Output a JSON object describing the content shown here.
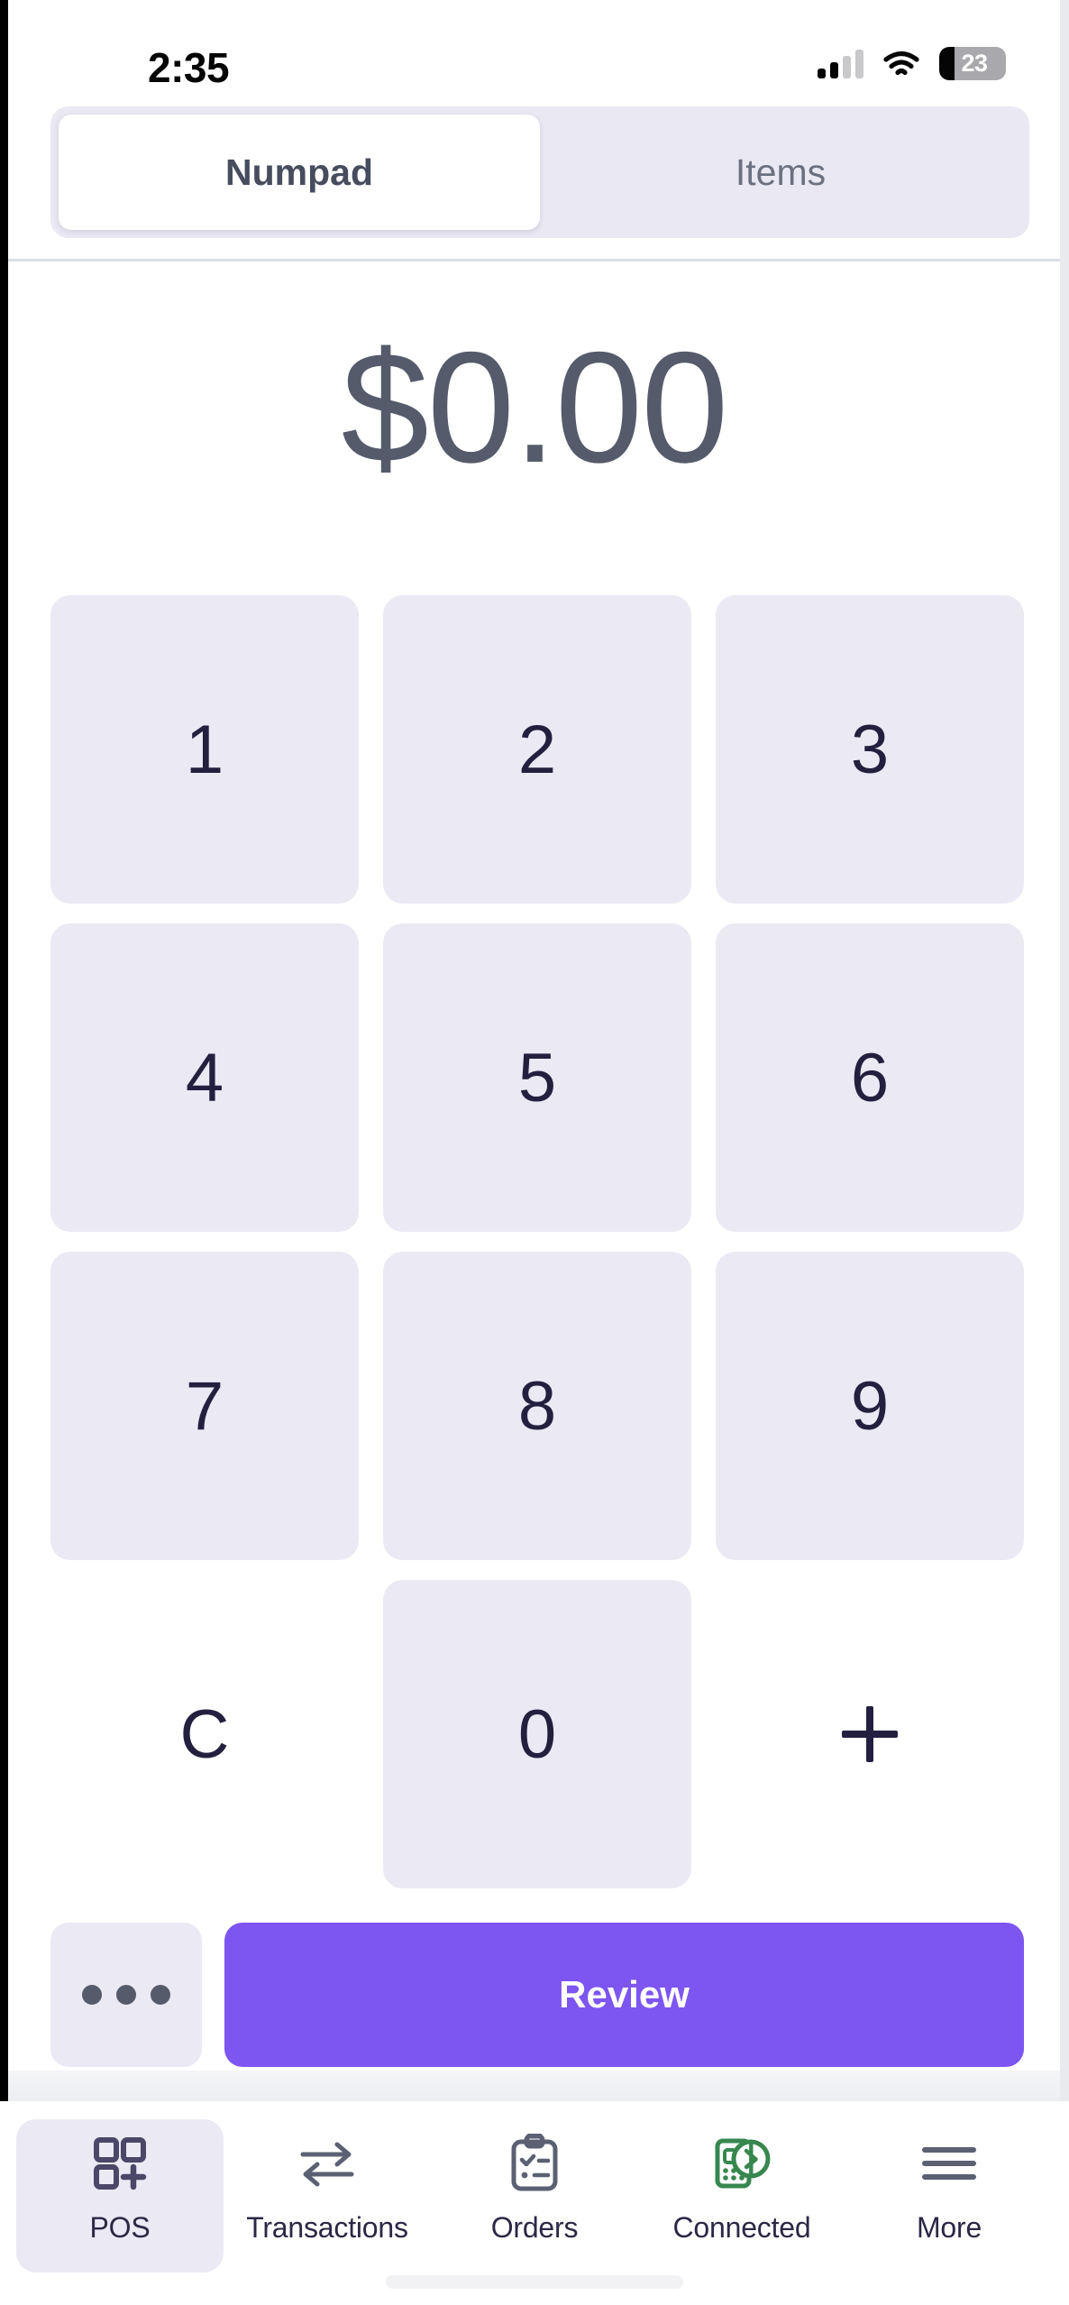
{
  "status_bar": {
    "time": "2:35",
    "battery_level": "23",
    "signal_bars_filled": 2,
    "signal_bars_total": 4,
    "icons": [
      "cellular-signal-icon",
      "wifi-icon",
      "battery-icon"
    ]
  },
  "segmented_tabs": {
    "items": [
      {
        "label": "Numpad",
        "active": true
      },
      {
        "label": "Items",
        "active": false
      }
    ]
  },
  "amount_display": {
    "value": "$0.00",
    "color": "#555b6b"
  },
  "numpad": {
    "keys": [
      {
        "label": "1",
        "filled": true
      },
      {
        "label": "2",
        "filled": true
      },
      {
        "label": "3",
        "filled": true
      },
      {
        "label": "4",
        "filled": true
      },
      {
        "label": "5",
        "filled": true
      },
      {
        "label": "6",
        "filled": true
      },
      {
        "label": "7",
        "filled": true
      },
      {
        "label": "8",
        "filled": true
      },
      {
        "label": "9",
        "filled": true
      },
      {
        "label": "C",
        "filled": false
      },
      {
        "label": "0",
        "filled": true
      },
      {
        "label": "+",
        "filled": false
      }
    ],
    "key_background": "#ebe9f4",
    "key_text_color": "#23203f"
  },
  "actions": {
    "more_label": "•••",
    "review_label": "Review",
    "review_color": "#7d55f0"
  },
  "bottom_nav": {
    "items": [
      {
        "label": "POS",
        "icon": "grid-plus-icon",
        "active": true,
        "color": "#4b4768"
      },
      {
        "label": "Transactions",
        "icon": "exchange-arrows-icon",
        "active": false,
        "color": "#5b6073"
      },
      {
        "label": "Orders",
        "icon": "clipboard-list-icon",
        "active": false,
        "color": "#5b6073"
      },
      {
        "label": "Connected",
        "icon": "card-reader-bluetooth-icon",
        "active": false,
        "color": "#37874f"
      },
      {
        "label": "More",
        "icon": "hamburger-menu-icon",
        "active": false,
        "color": "#5b6073"
      }
    ],
    "active_background": "#ebe9f4"
  }
}
